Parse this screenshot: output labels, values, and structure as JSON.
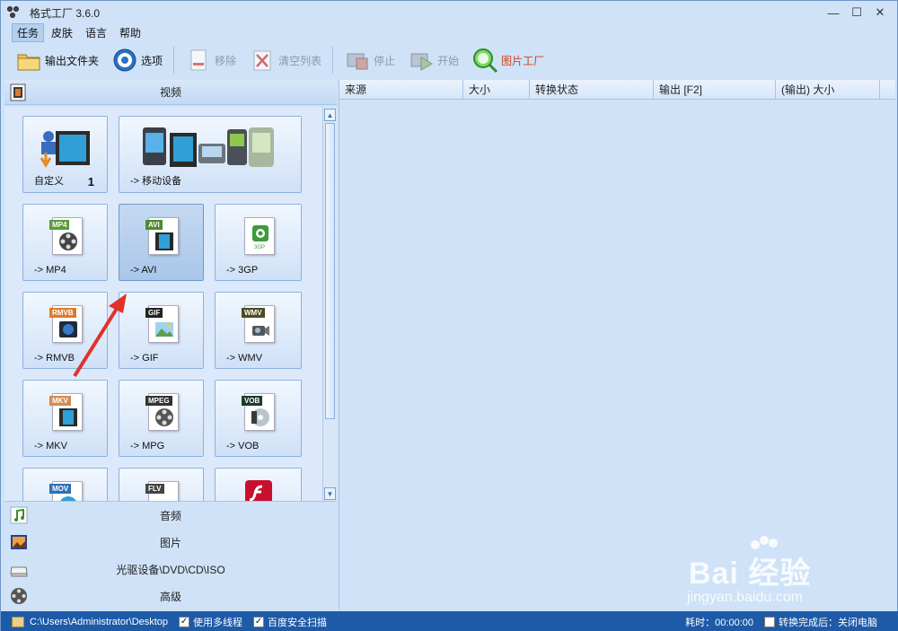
{
  "window": {
    "title": "格式工厂 3.6.0",
    "minimize": "—",
    "maximize": "☐",
    "close": "✕"
  },
  "menu": [
    "任务",
    "皮肤",
    "语言",
    "帮助"
  ],
  "toolbar": {
    "output_folder": "输出文件夹",
    "options": "选项",
    "remove": "移除",
    "clear_list": "清空列表",
    "stop": "停止",
    "start": "开始",
    "picture_factory": "图片工厂"
  },
  "left": {
    "video_header": "视频",
    "tiles": {
      "custom": "自定义",
      "custom_count": "1",
      "mobile": "-> 移动设备",
      "mp4": "-> MP4",
      "avi": "-> AVI",
      "3gp": "-> 3GP",
      "rmvb": "-> RMVB",
      "gif": "-> GIF",
      "wmv": "-> WMV",
      "mkv": "-> MKV",
      "mpg": "-> MPG",
      "vob": "-> VOB"
    },
    "badges": {
      "mp4": "MP4",
      "avi": "AVI",
      "3gp": "3GP",
      "rmvb": "RMVB",
      "gif": "GIF",
      "wmv": "WMV",
      "mkv": "MKV",
      "mpeg": "MPEG",
      "vob": "VOB",
      "mov": "MOV",
      "flv": "FLV"
    },
    "categories": {
      "audio": "音频",
      "picture": "图片",
      "rom": "光驱设备\\DVD\\CD\\ISO",
      "advanced": "高级"
    }
  },
  "table": {
    "columns": [
      "来源",
      "大小",
      "转换状态",
      "输出 [F2]",
      "(输出) 大小"
    ]
  },
  "status": {
    "path": "C:\\Users\\Administrator\\Desktop",
    "multithread": "使用多线程",
    "baidu_scan": "百度安全扫描",
    "elapsed": "耗时：00:00:00",
    "after_done": "转换完成后：关闭电脑"
  },
  "watermark": {
    "brand": "Bai 经验",
    "url": "jingyan.baidu.com"
  },
  "colors": {
    "accent": "#1d5aa8",
    "brand_orange": "#d6401a"
  }
}
